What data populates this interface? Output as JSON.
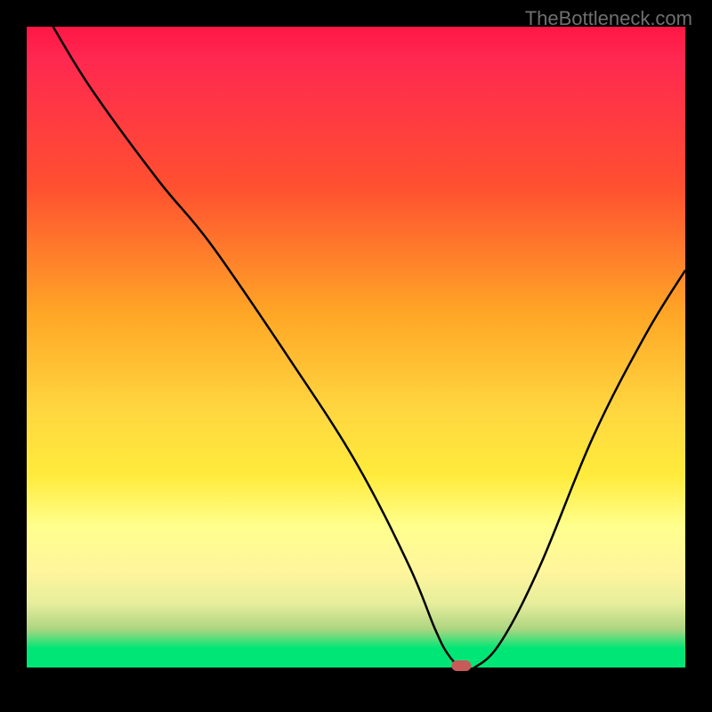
{
  "watermark": "TheBottleneck.com",
  "chart_data": {
    "type": "line",
    "title": "",
    "xlabel": "",
    "ylabel": "",
    "xlim": [
      0,
      100
    ],
    "ylim": [
      0,
      100
    ],
    "grid": false,
    "legend": false,
    "background": "rainbow_gradient_red_to_green",
    "series": [
      {
        "name": "bottleneck-curve",
        "x": [
          4,
          10,
          20,
          28,
          40,
          50,
          58,
          62,
          64,
          66,
          68,
          72,
          78,
          86,
          94,
          100
        ],
        "y": [
          100,
          90,
          76,
          66,
          48,
          32,
          16,
          6,
          2,
          0,
          0,
          4,
          16,
          36,
          52,
          62
        ]
      }
    ],
    "marker": {
      "name": "optimal-point",
      "x": 66,
      "y": 0,
      "shape": "rounded-rect",
      "color": "#c85a5a"
    }
  }
}
